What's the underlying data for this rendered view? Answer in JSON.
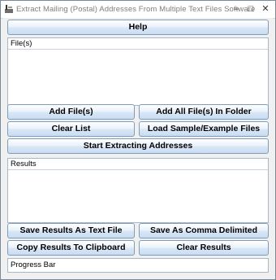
{
  "window": {
    "title": "Extract Mailing (Postal) Addresses From Multiple Text Files Software",
    "minimize_label": "–",
    "maximize_label": "□",
    "close_label": "✕"
  },
  "buttons": {
    "help": "Help",
    "add_files": "Add File(s)",
    "add_all_files_in_folder": "Add All File(s) In Folder",
    "clear_list": "Clear List",
    "load_sample": "Load Sample/Example Files",
    "start_extracting": "Start Extracting Addresses",
    "save_results_text": "Save Results As Text File",
    "save_comma_delimited": "Save As Comma Delimited",
    "copy_results": "Copy Results To Clipboard",
    "clear_results": "Clear Results"
  },
  "files_panel": {
    "label": "File(s)"
  },
  "results_panel": {
    "label": "Results"
  },
  "status": {
    "progress_label": "Progress Bar"
  },
  "icons": {
    "app": "app-icon",
    "minimize": "minimize-icon",
    "maximize": "maximize-icon",
    "close": "close-icon"
  }
}
